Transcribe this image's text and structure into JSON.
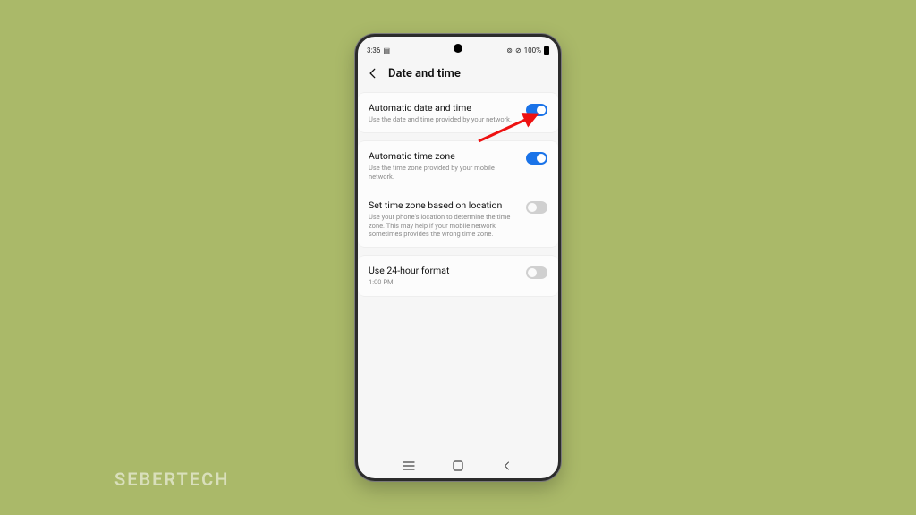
{
  "watermark": "SEBERTECH",
  "statusbar": {
    "time": "3:36",
    "battery_text": "100%"
  },
  "header": {
    "title": "Date and time"
  },
  "settings": {
    "auto_datetime": {
      "title": "Automatic date and time",
      "sub": "Use the date and time provided by your network."
    },
    "auto_tz": {
      "title": "Automatic time zone",
      "sub": "Use the time zone provided by your mobile network."
    },
    "tz_location": {
      "title": "Set time zone based on location",
      "sub": "Use your phone's location to determine the time zone. This may help if your mobile network sometimes provides the wrong time zone."
    },
    "hour24": {
      "title": "Use 24-hour format",
      "sub": "1:00 PM"
    }
  }
}
